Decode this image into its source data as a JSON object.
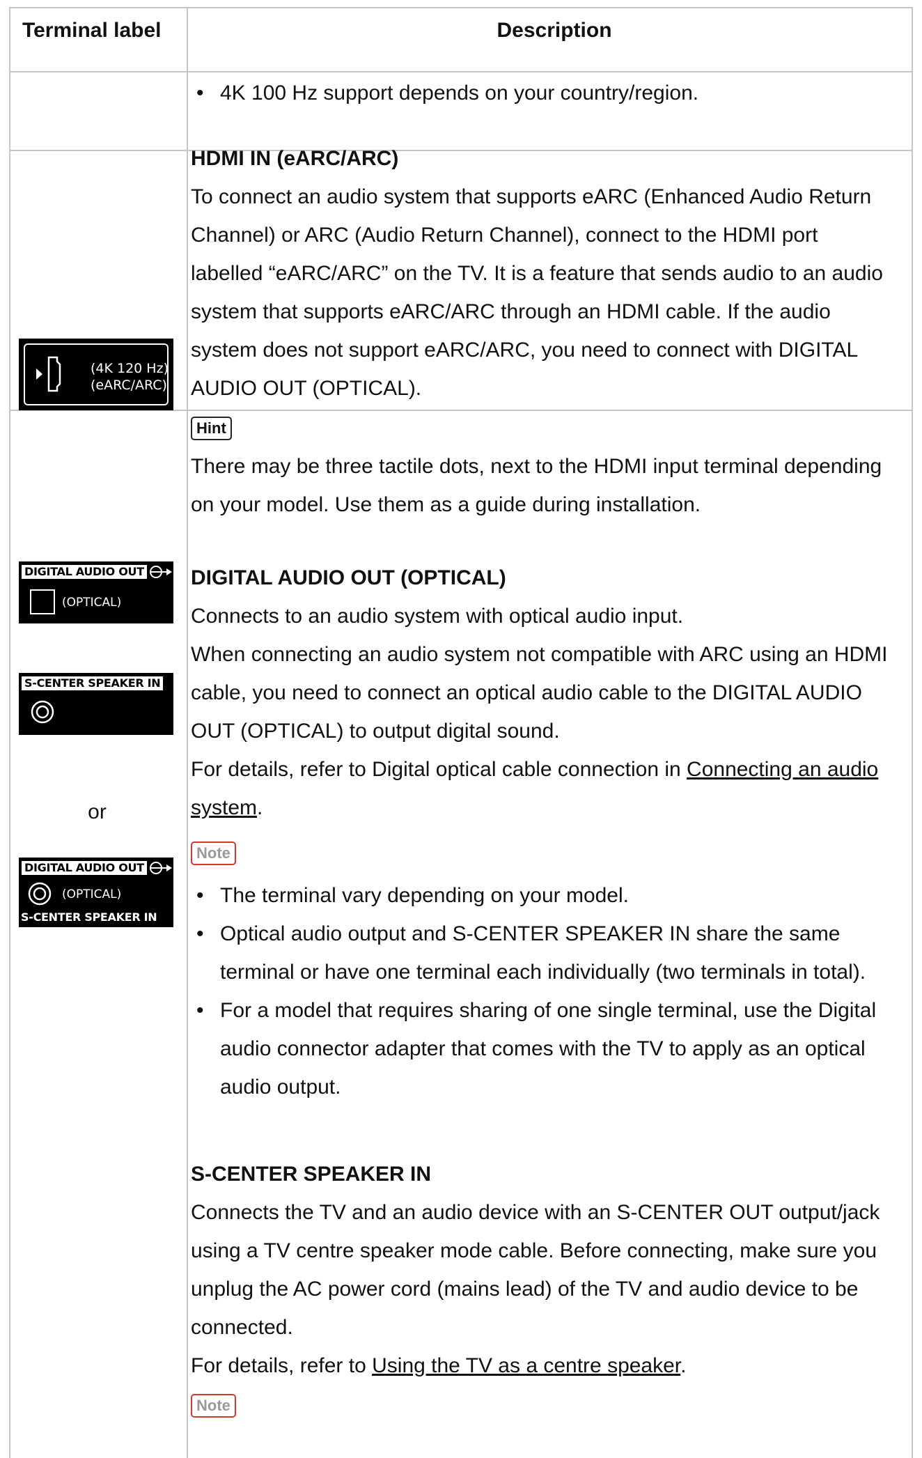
{
  "table": {
    "headers": {
      "terminal_label": "Terminal label",
      "description": "Description"
    }
  },
  "row_4k": {
    "bullet": "4K 100 Hz support depends on your country/region."
  },
  "row_hdmi": {
    "image_label_line1": "(4K 120 Hz)",
    "image_label_line2": "(eARC/ARC)",
    "heading": "HDMI IN (eARC/ARC)",
    "body": "To connect an audio system that supports eARC (Enhanced Audio Return Channel) or ARC (Audio Return Channel), connect to the HDMI port labelled “eARC/ARC” on the TV. It is a feature that sends audio to an audio system that supports eARC/ARC through an HDMI cable. If the audio system does not support eARC/ARC, you need to connect with DIGITAL AUDIO OUT (OPTICAL).",
    "hint_label": "Hint",
    "hint_text": "There may be three tactile dots, next to the HDMI input terminal depending on your model. Use them as a guide during installation."
  },
  "row_optical": {
    "images": {
      "a_top": "DIGITAL AUDIO OUT",
      "a_sub": "(OPTICAL)",
      "b_top": "S-CENTER SPEAKER IN",
      "or": "or",
      "c_top": "DIGITAL AUDIO OUT",
      "c_sub": "(OPTICAL)",
      "c_bottom": "S-CENTER SPEAKER IN"
    },
    "heading": "DIGITAL AUDIO OUT (OPTICAL)",
    "line1": "Connects to an audio system with optical audio input.",
    "line2": "When connecting an audio system not compatible with ARC using an HDMI cable, you need to connect an optical audio cable to the DIGITAL AUDIO OUT (OPTICAL) to output digital sound.",
    "details_prefix": "For details, refer to Digital optical cable connection in ",
    "details_link": "Connecting an audio system",
    "details_suffix": ".",
    "note_label": "Note",
    "notes": [
      "The terminal vary depending on your model.",
      "Optical audio output and S-CENTER SPEAKER IN share the same terminal or have one terminal each individually (two terminals in total).",
      "For a model that requires sharing of one single terminal, use the Digital audio connector adapter that comes with the TV to apply as an optical audio output."
    ],
    "heading2": "S-CENTER SPEAKER IN",
    "body2": "Connects the TV and an audio device with an S-CENTER OUT output/jack using a TV centre speaker mode cable. Before connecting, make sure you unplug the AC power cord (mains lead) of the TV and audio device to be connected.",
    "details2_prefix": "For details, refer to ",
    "details2_link": "Using the TV as a centre speaker",
    "details2_suffix": ".",
    "note2_label": "Note"
  }
}
